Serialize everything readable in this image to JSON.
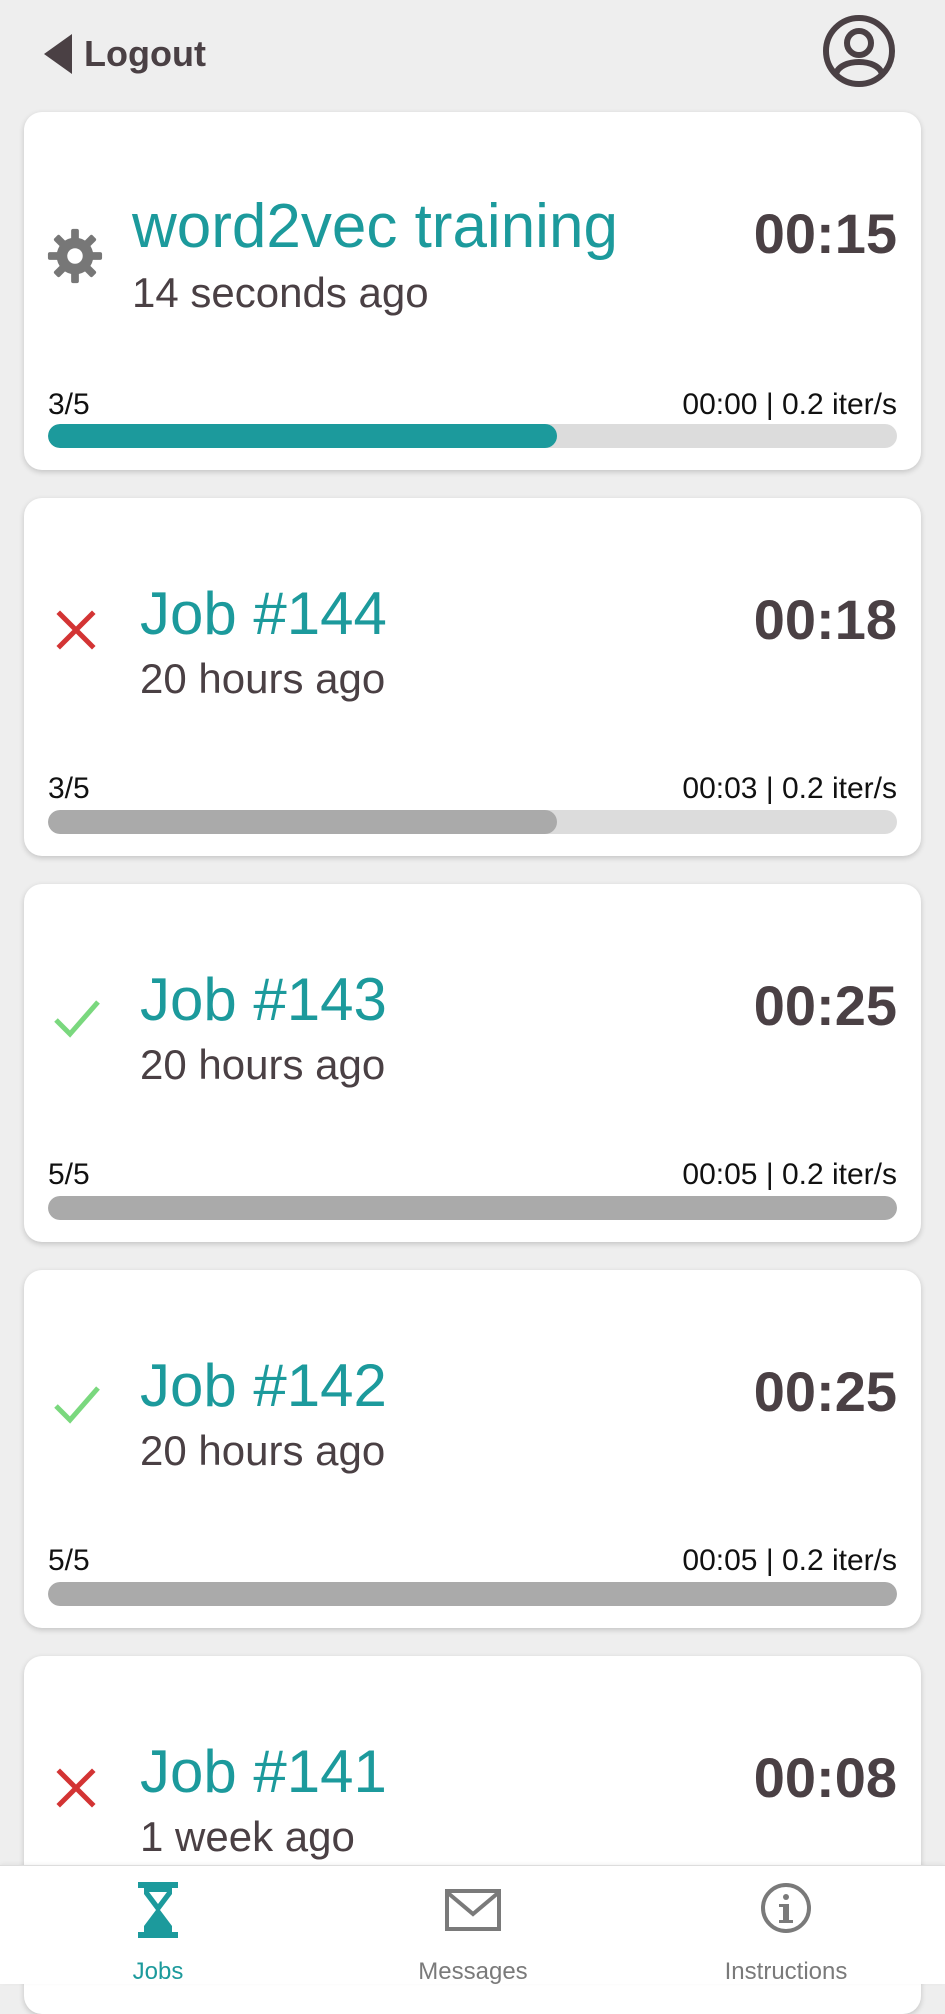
{
  "header": {
    "logout_label": "Logout"
  },
  "colors": {
    "accent": "#1c9a9c",
    "error": "#d33434",
    "success": "#7ad87e",
    "done_bar": "#aaaaaa",
    "track": "#dcdcdc"
  },
  "jobs": [
    {
      "title": "word2vec training",
      "time_ago": "14 seconds ago",
      "duration": "00:15",
      "progress_label": "3/5",
      "stats": "00:00 | 0.2 iter/s",
      "progress": 0.6,
      "status": "running",
      "status_icon": "gear-icon"
    },
    {
      "title": "Job #144",
      "time_ago": "20 hours ago",
      "duration": "00:18",
      "progress_label": "3/5",
      "stats": "00:03 | 0.2 iter/s",
      "progress": 0.6,
      "status": "failed",
      "status_icon": "x-icon"
    },
    {
      "title": "Job #143",
      "time_ago": "20 hours ago",
      "duration": "00:25",
      "progress_label": "5/5",
      "stats": "00:05 | 0.2 iter/s",
      "progress": 1.0,
      "status": "success",
      "status_icon": "check-icon"
    },
    {
      "title": "Job #142",
      "time_ago": "20 hours ago",
      "duration": "00:25",
      "progress_label": "5/5",
      "stats": "00:05 | 0.2 iter/s",
      "progress": 1.0,
      "status": "success",
      "status_icon": "check-icon"
    },
    {
      "title": "Job #141",
      "time_ago": "1 week ago",
      "duration": "00:08",
      "status": "failed",
      "status_icon": "x-icon"
    }
  ],
  "nav": [
    {
      "label": "Jobs",
      "icon": "hourglass-icon",
      "active": true
    },
    {
      "label": "Messages",
      "icon": "envelope-icon",
      "active": false
    },
    {
      "label": "Instructions",
      "icon": "info-icon",
      "active": false
    }
  ]
}
